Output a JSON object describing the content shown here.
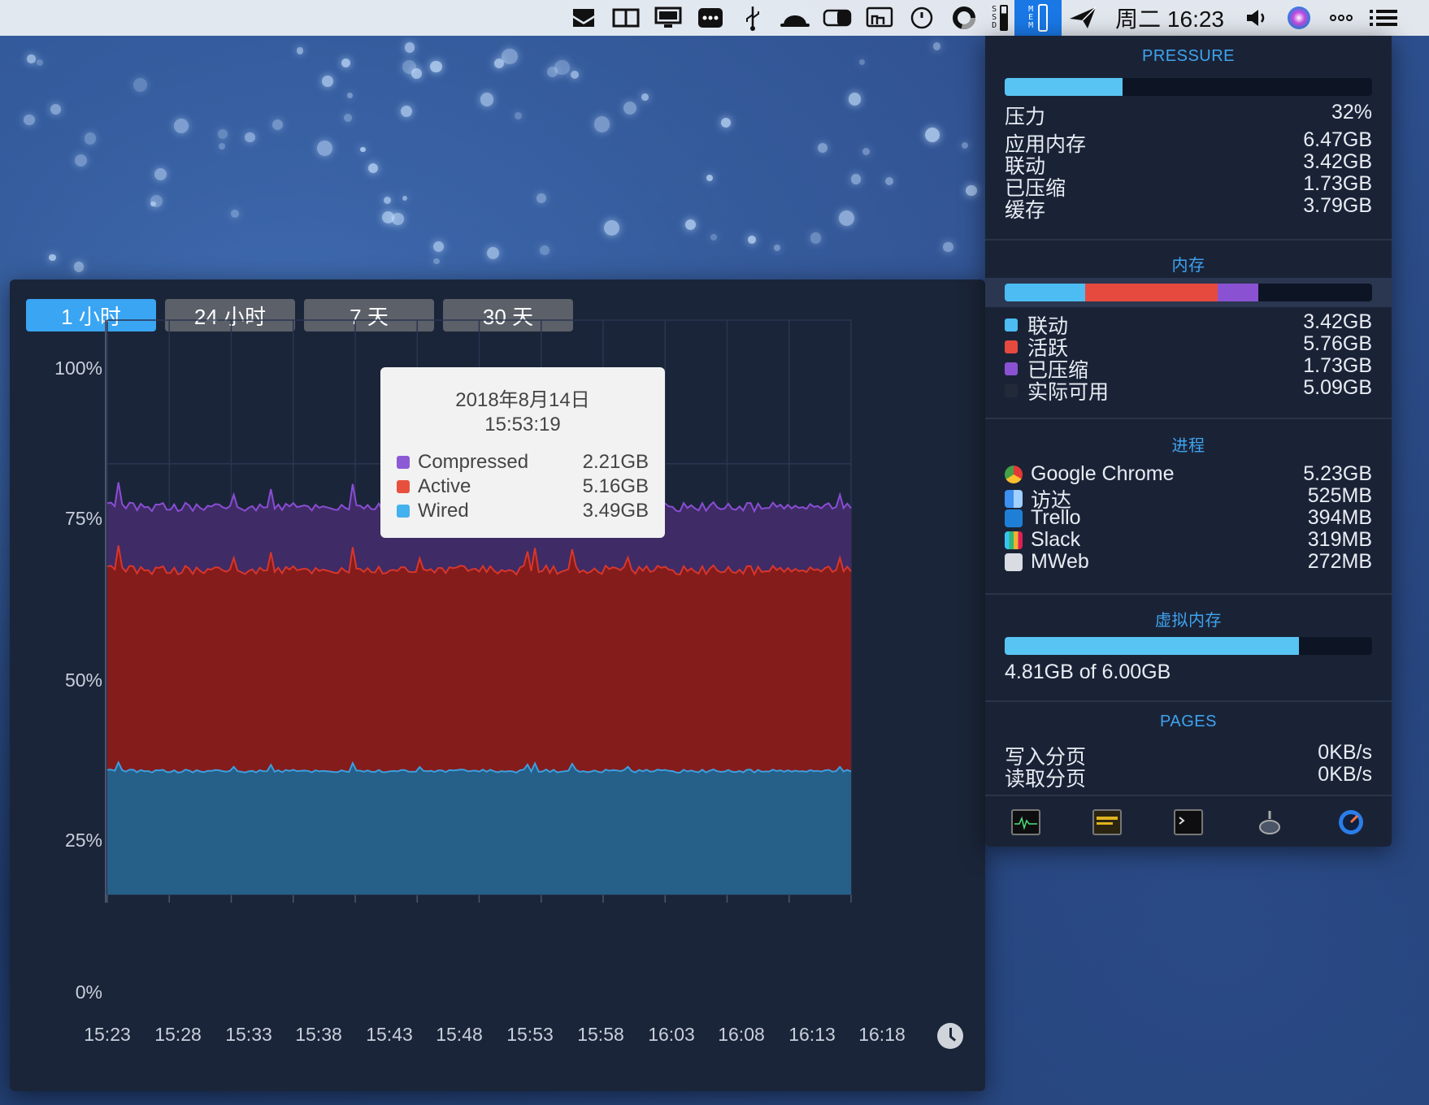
{
  "menubar": {
    "clock": "周二 16:23",
    "icons": [
      "inbox-icon",
      "split-view-icon",
      "display-icon",
      "more-dots-icon",
      "usb-icon",
      "hat-icon",
      "toggle-icon",
      "screen-share-icon",
      "circle-icon",
      "disk-ring-icon",
      "ssd-icon",
      "mem-icon",
      "paperplane-icon",
      "volume-icon",
      "siri-icon",
      "more-icon",
      "list-icon"
    ],
    "ssd_letters": [
      "S",
      "S",
      "D"
    ],
    "mem_letters": [
      "M",
      "E",
      "M"
    ]
  },
  "chart_window": {
    "tabs": [
      {
        "label": "1 小时",
        "active": true
      },
      {
        "label": "24 小时",
        "active": false
      },
      {
        "label": "7 天",
        "active": false
      },
      {
        "label": "30 天",
        "active": false
      }
    ],
    "tooltip": {
      "date": "2018年8月14日",
      "time": "15:53:19",
      "rows": [
        {
          "name": "Compressed",
          "value": "2.21GB",
          "color": "#8d5ad6"
        },
        {
          "name": "Active",
          "value": "5.16GB",
          "color": "#e8503e"
        },
        {
          "name": "Wired",
          "value": "3.49GB",
          "color": "#43b1ee"
        }
      ]
    }
  },
  "chart_data": {
    "type": "area",
    "stacked": true,
    "y_ticks": [
      "100%",
      "75%",
      "50%",
      "25%",
      "0%"
    ],
    "ylim": [
      0,
      100
    ],
    "x_ticks": [
      "15:23",
      "15:28",
      "15:33",
      "15:38",
      "15:43",
      "15:48",
      "15:53",
      "15:58",
      "16:03",
      "16:08",
      "16:13",
      "16:18"
    ],
    "series": [
      {
        "name": "Wired",
        "color": "#265f87",
        "line": "#3b9fe0",
        "level": 21.5
      },
      {
        "name": "Active",
        "color": "#841c1b",
        "line": "#d8362b",
        "level": 56.5
      },
      {
        "name": "Compressed",
        "color": "#3f2b66",
        "line": "#8a4dd4",
        "level": 67.5
      }
    ],
    "grid": true
  },
  "panel": {
    "pressure": {
      "title": "PRESSURE",
      "bar_fill": 0.32,
      "rows": [
        {
          "label": "压力",
          "value": "32%"
        },
        {
          "label": "应用内存",
          "value": "6.47GB"
        },
        {
          "label": "联动",
          "value": "3.42GB"
        },
        {
          "label": "已压缩",
          "value": "1.73GB"
        },
        {
          "label": "缓存",
          "value": "3.79GB"
        }
      ]
    },
    "memory": {
      "title": "内存",
      "bar_segments": [
        {
          "name": "联动",
          "fraction": 0.22,
          "color": "#4cbcf2"
        },
        {
          "name": "活跃",
          "fraction": 0.36,
          "color": "#e64a3f"
        },
        {
          "name": "已压缩",
          "fraction": 0.11,
          "color": "#8a52d2"
        }
      ],
      "rows": [
        {
          "label": "联动",
          "value": "3.42GB",
          "color": "#4cbcf2"
        },
        {
          "label": "活跃",
          "value": "5.76GB",
          "color": "#e64a3f"
        },
        {
          "label": "已压缩",
          "value": "1.73GB",
          "color": "#8a52d2"
        },
        {
          "label": "实际可用",
          "value": "5.09GB",
          "color": "#222a3a"
        }
      ]
    },
    "processes": {
      "title": "进程",
      "rows": [
        {
          "label": "Google Chrome",
          "value": "5.23GB",
          "icon": "chrome-icon"
        },
        {
          "label": "访达",
          "value": "525MB",
          "icon": "finder-icon"
        },
        {
          "label": "Trello",
          "value": "394MB",
          "icon": "trello-icon"
        },
        {
          "label": "Slack",
          "value": "319MB",
          "icon": "slack-icon"
        },
        {
          "label": "MWeb",
          "value": "272MB",
          "icon": "mweb-icon"
        }
      ]
    },
    "virtual_memory": {
      "title": "虚拟内存",
      "bar_fill": 0.8,
      "text": "4.81GB of 6.00GB"
    },
    "pages": {
      "title": "PAGES",
      "rows": [
        {
          "label": "写入分页",
          "value": "0KB/s"
        },
        {
          "label": "读取分页",
          "value": "0KB/s"
        }
      ]
    },
    "dock": [
      "activity-monitor-icon",
      "console-icon",
      "terminal-icon",
      "disk-utility-icon",
      "istat-icon"
    ]
  }
}
